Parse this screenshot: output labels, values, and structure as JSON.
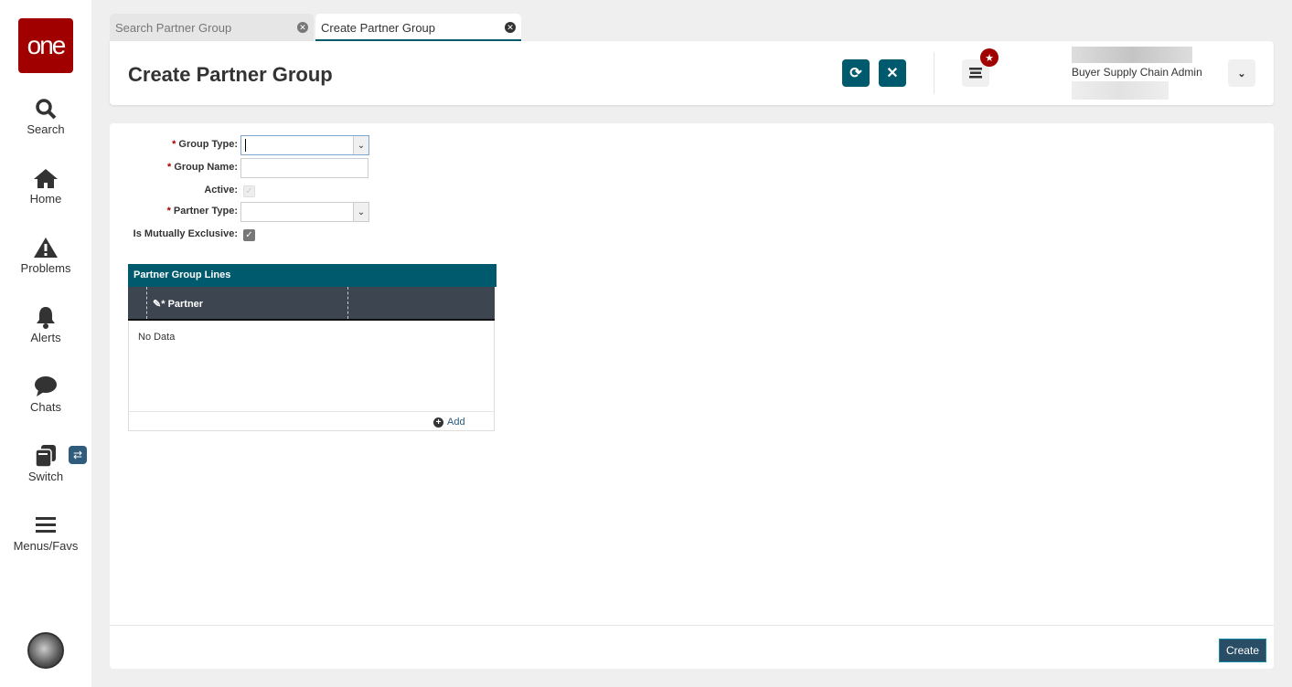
{
  "sidebar": {
    "logo": "one",
    "items": [
      {
        "label": "Search"
      },
      {
        "label": "Home"
      },
      {
        "label": "Problems"
      },
      {
        "label": "Alerts"
      },
      {
        "label": "Chats"
      },
      {
        "label": "Switch"
      },
      {
        "label": "Menus/Favs"
      }
    ]
  },
  "tabs": [
    {
      "label": "Search Partner Group"
    },
    {
      "label": "Create Partner Group"
    }
  ],
  "header": {
    "title": "Create Partner Group",
    "role": "Buyer Supply Chain Admin"
  },
  "form": {
    "group_type": "Group Type:",
    "group_name": "Group Name:",
    "active": "Active:",
    "partner_type": "Partner Type:",
    "mutually_exclusive": "Is Mutually Exclusive:",
    "required": "*"
  },
  "grid": {
    "title": "Partner Group Lines",
    "column": "Partner",
    "empty": "No Data",
    "add": "Add"
  },
  "footer": {
    "create": "Create"
  }
}
